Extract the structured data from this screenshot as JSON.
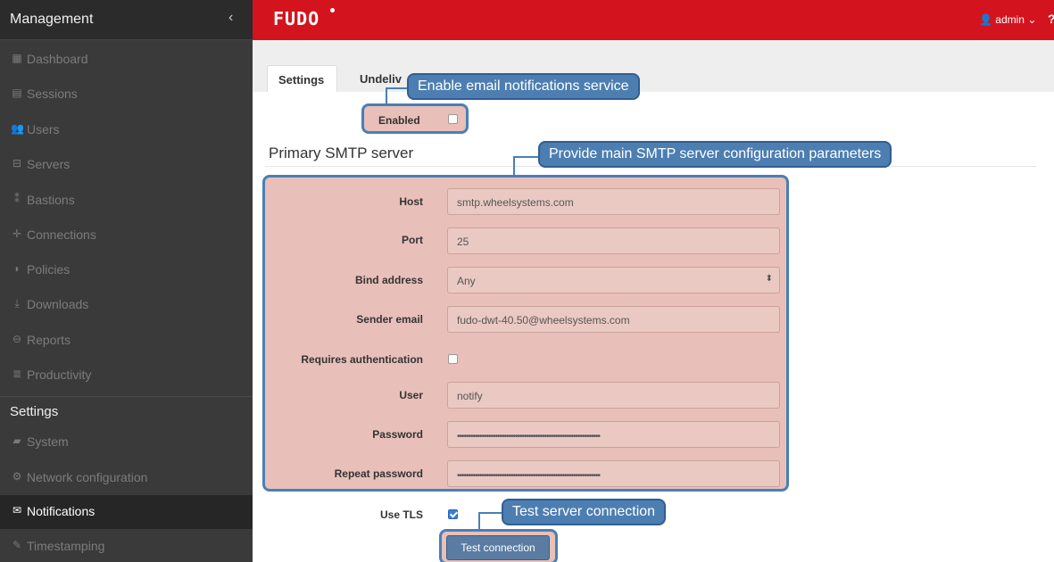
{
  "sidebar": {
    "title": "Management",
    "collapse_icon": "‹",
    "items": [
      {
        "label": "Dashboard",
        "icon": "▦"
      },
      {
        "label": "Sessions",
        "icon": "▤"
      },
      {
        "label": "Users",
        "icon": "👥"
      },
      {
        "label": "Servers",
        "icon": "⊟"
      },
      {
        "label": "Bastions",
        "icon": "⁑"
      },
      {
        "label": "Connections",
        "icon": "✛"
      },
      {
        "label": "Policies",
        "icon": "◗"
      },
      {
        "label": "Downloads",
        "icon": "⤓"
      },
      {
        "label": "Reports",
        "icon": "⊖"
      },
      {
        "label": "Productivity",
        "icon": "≣"
      }
    ],
    "settings_section": "Settings",
    "settings_items": [
      {
        "label": "System",
        "icon": "▰"
      },
      {
        "label": "Network configuration",
        "icon": "⚙"
      },
      {
        "label": "Notifications",
        "icon": "✉"
      },
      {
        "label": "Timestamping",
        "icon": "✎"
      }
    ]
  },
  "topbar": {
    "logo": "FUDO",
    "user": "admin",
    "user_caret": "⌄",
    "help": "?"
  },
  "tabs": {
    "settings": "Settings",
    "undelivered": "Undeliv"
  },
  "form": {
    "enabled_label": "Enabled",
    "section_title": "Primary SMTP server",
    "host_label": "Host",
    "host_value": "smtp.wheelsystems.com",
    "port_label": "Port",
    "port_value": "25",
    "bind_label": "Bind address",
    "bind_value": "Any",
    "sender_label": "Sender email",
    "sender_value": "fudo-dwt-40.50@wheelsystems.com",
    "auth_label": "Requires authentication",
    "user_label": "User",
    "user_value": "notify",
    "password_label": "Password",
    "password_value": "••••••••••••••••••••••••••••••••••••••••••••••••••••••••••••••••",
    "repeat_label": "Repeat password",
    "repeat_value": "••••••••••••••••••••••••••••••••••••••••••••••••••••••••••••••••",
    "tls_label": "Use TLS",
    "test_button": "Test connection"
  },
  "callouts": {
    "enable": "Enable email notifications service",
    "smtp": "Provide main SMTP server configuration parameters",
    "test": "Test server connection"
  },
  "colors": {
    "brand_red": "#d3141e",
    "callout_blue": "#4d7eb1",
    "sidebar_bg": "#3a3a3a"
  }
}
